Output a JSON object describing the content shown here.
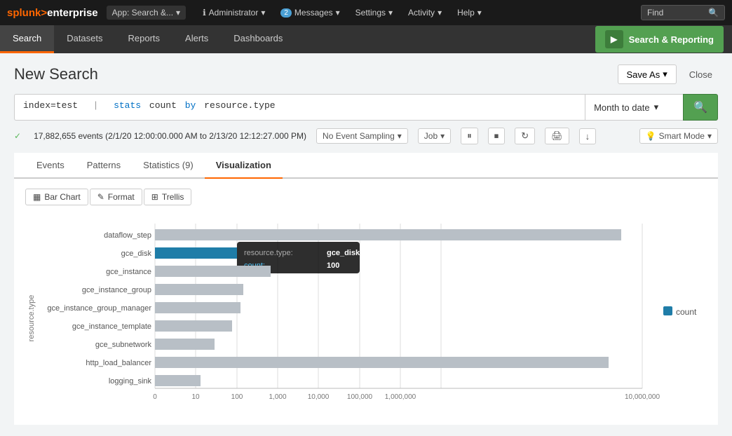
{
  "topNav": {
    "logo": {
      "splunk": "splunk>",
      "enterprise": "enterprise"
    },
    "app": "App: Search &...",
    "items": [
      {
        "label": "Administrator",
        "hasCaret": true
      },
      {
        "label": "Messages",
        "badge": "2",
        "badgeColor": "#4a9fd4",
        "hasCaret": true
      },
      {
        "label": "Settings",
        "hasCaret": true
      },
      {
        "label": "Activity",
        "hasCaret": true
      },
      {
        "label": "Help",
        "hasCaret": true
      }
    ],
    "find_placeholder": "Find",
    "search_reporting_label": "Search & Reporting",
    "play_icon": "▶"
  },
  "secNav": {
    "tabs": [
      {
        "label": "Search",
        "active": true
      },
      {
        "label": "Datasets",
        "active": false
      },
      {
        "label": "Reports",
        "active": false
      },
      {
        "label": "Alerts",
        "active": false
      },
      {
        "label": "Dashboards",
        "active": false
      }
    ]
  },
  "page": {
    "title": "New Search",
    "save_as_label": "Save As",
    "close_label": "Close"
  },
  "searchBar": {
    "query": "index=test  |  stats count by resource.type",
    "query_index": "index=test",
    "query_pipe": "|",
    "query_stats": "stats",
    "query_count": "count",
    "query_by": "by",
    "query_field": "resource.type",
    "time_range": "Month to date",
    "run_icon": "🔍"
  },
  "statusRow": {
    "check_icon": "✓",
    "events_text": "17,882,655 events (2/1/20 12:00:00.000 AM to 2/13/20 12:12:27.000 PM)",
    "no_event_sampling": "No Event Sampling",
    "job_label": "Job",
    "smart_mode_label": "Smart Mode",
    "icon_pause": "⏸",
    "icon_stop": "⏹",
    "icon_refresh": "↻",
    "icon_print": "🖨",
    "icon_download": "↓"
  },
  "contentTabs": {
    "tabs": [
      {
        "label": "Events",
        "active": false
      },
      {
        "label": "Patterns",
        "active": false
      },
      {
        "label": "Statistics (9)",
        "active": false
      },
      {
        "label": "Visualization",
        "active": true
      }
    ]
  },
  "chartToolbar": {
    "bar_chart_label": "Bar Chart",
    "format_label": "Format",
    "trellis_label": "Trellis",
    "bar_icon": "▦",
    "format_icon": "✎",
    "trellis_icon": "⊞"
  },
  "chart": {
    "y_axis_label": "resource.type",
    "rows": [
      {
        "label": "dataflow_step",
        "value": 8000000,
        "highlight": false
      },
      {
        "label": "gce_disk",
        "value": 100,
        "highlight": true
      },
      {
        "label": "gce_instance",
        "value": 350,
        "highlight": false
      },
      {
        "label": "gce_instance_group",
        "value": 280,
        "highlight": false
      },
      {
        "label": "gce_instance_group_manager",
        "value": 270,
        "highlight": false
      },
      {
        "label": "gce_instance_template",
        "value": 240,
        "highlight": false
      },
      {
        "label": "gce_subnetwork",
        "value": 200,
        "highlight": false
      },
      {
        "label": "http_load_balancer",
        "value": 7500000,
        "highlight": false
      },
      {
        "label": "logging_sink",
        "value": 150,
        "highlight": false
      }
    ],
    "x_axis_labels": [
      "0",
      "10",
      "100",
      "1,000",
      "10,000",
      "100,000",
      "1,000,000",
      "10,000,000"
    ],
    "max_value": 10000000,
    "tooltip": {
      "key_label": "resource.type:",
      "key_value": "gce_disk",
      "count_label": "count:",
      "count_value": "100"
    },
    "legend_label": "count"
  }
}
